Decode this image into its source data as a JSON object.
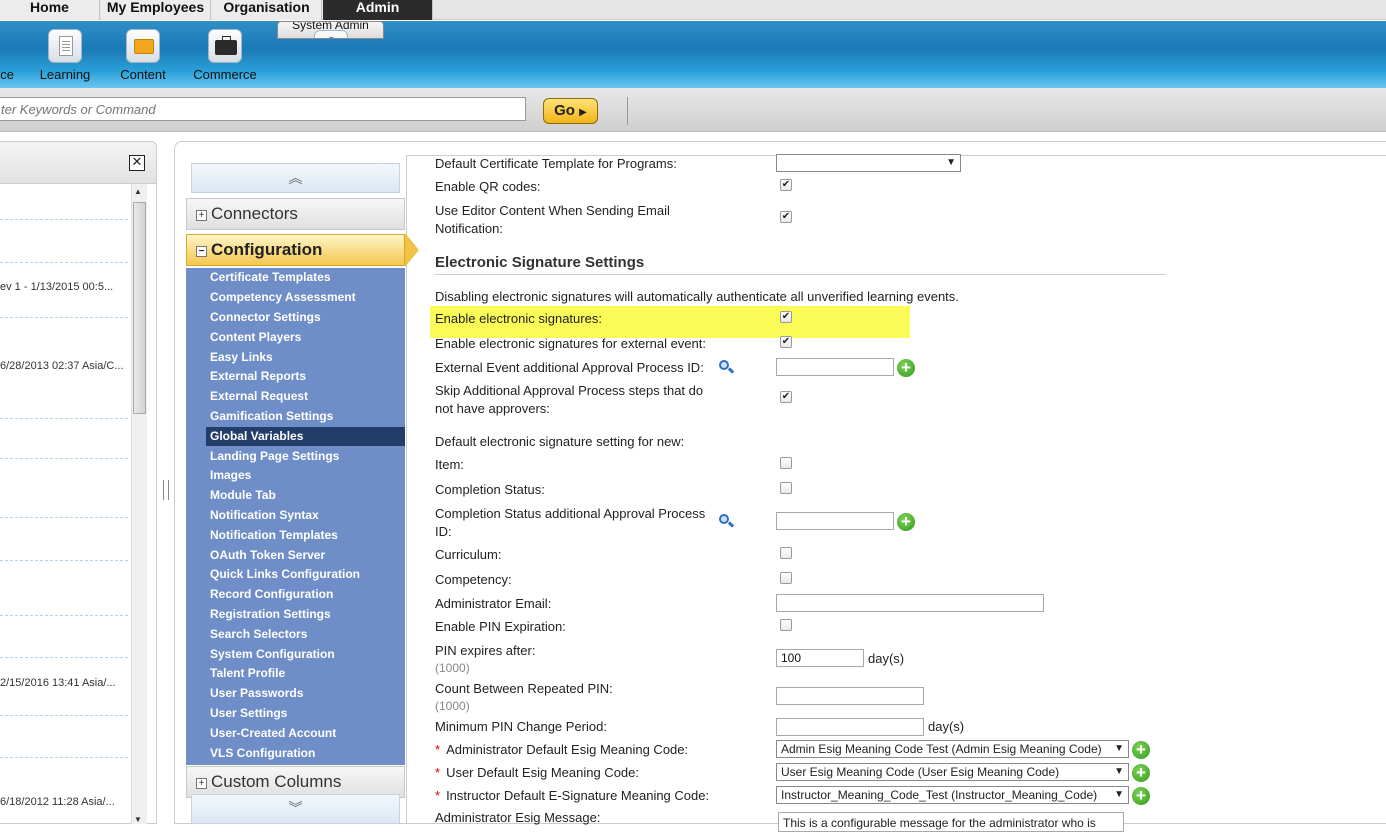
{
  "top_tabs": [
    "Home",
    "My Employees",
    "Organisation",
    "Admin"
  ],
  "ribbon": {
    "items": [
      {
        "label": "ce",
        "icon": "partial-icon"
      },
      {
        "label": "Learning",
        "icon": "document-icon"
      },
      {
        "label": "Content",
        "icon": "folder-icon"
      },
      {
        "label": "Commerce",
        "icon": "briefcase-icon"
      },
      {
        "label": "System Admin",
        "icon": "admin-user-icon"
      }
    ]
  },
  "search": {
    "placeholder": "ter Keywords or Command",
    "go_label": "Go"
  },
  "left_panel": {
    "rows": [
      "ev 1 - 1/13/2015 00:5...",
      "6/28/2013 02:37 Asia/C...",
      "2/15/2016 13:41 Asia/...",
      "6/18/2012 11:28 Asia/..."
    ]
  },
  "accordion": {
    "connectors": "Connectors",
    "configuration": "Configuration",
    "custom_columns": "Custom Columns",
    "items": [
      "Certificate Templates",
      "Competency Assessment",
      "Connector Settings",
      "Content Players",
      "Easy Links",
      "External Reports",
      "External Request",
      "Gamification Settings",
      "Global Variables",
      "Landing Page Settings",
      "Images",
      "Module Tab",
      "Notification Syntax",
      "Notification Templates",
      "OAuth Token Server",
      "Quick Links Configuration",
      "Record Configuration",
      "Registration Settings",
      "Search Selectors",
      "System Configuration",
      "Talent Profile",
      "User Passwords",
      "User Settings",
      "User-Created Account",
      "VLS Configuration"
    ],
    "active_item": "Global Variables"
  },
  "settings": {
    "default_cert_template": "Default Certificate Template for Programs:",
    "enable_qr": "Enable QR codes:",
    "use_editor_1": "Use Editor Content When Sending Email",
    "use_editor_2": "Notification:",
    "section_title": "Electronic Signature Settings",
    "disabling_note": "Disabling electronic signatures will automatically authenticate all unverified learning events.",
    "enable_esig": "Enable electronic signatures:",
    "enable_esig_external": "Enable electronic signatures for external event:",
    "external_event_approval": "External Event additional Approval Process ID:",
    "skip_steps_1": "Skip Additional Approval Process steps that do",
    "skip_steps_2": "not have approvers:",
    "default_setting_new": "Default electronic signature setting for new:",
    "item": "Item:",
    "completion_status": "Completion Status:",
    "completion_approval_1": "Completion Status additional Approval Process",
    "completion_approval_2": "ID:",
    "curriculum": "Curriculum:",
    "competency": "Competency:",
    "admin_email": "Administrator Email:",
    "enable_pin_exp": "Enable PIN Expiration:",
    "pin_expires": "PIN expires after:",
    "pin_expires_hint": "(1000)",
    "pin_expires_value": "100",
    "days_unit": "day(s)",
    "count_repeated_pin": "Count Between Repeated PIN:",
    "count_hint": "(1000)",
    "min_pin_change": "Minimum PIN Change Period:",
    "admin_esig_code": "Administrator Default Esig Meaning Code:",
    "admin_esig_value": "Admin Esig Meaning Code Test (Admin Esig Meaning Code)",
    "user_esig_code": "User Default Esig Meaning Code:",
    "user_esig_value": "User Esig Meaning Code (User Esig Meaning Code)",
    "instructor_esig_code": "Instructor Default E-Signature Meaning Code:",
    "instructor_esig_value": "Instructor_Meaning_Code_Test (Instructor_Meaning_Code)",
    "admin_esig_message": "Administrator Esig Message:",
    "admin_esig_message_value": "This is a configurable message for the administrator who is"
  },
  "colors": {
    "highlight": "#fbfb57",
    "nav_bg": "#6f8ec8",
    "nav_active": "#233d6b",
    "ribbon": "#1b79b6"
  }
}
